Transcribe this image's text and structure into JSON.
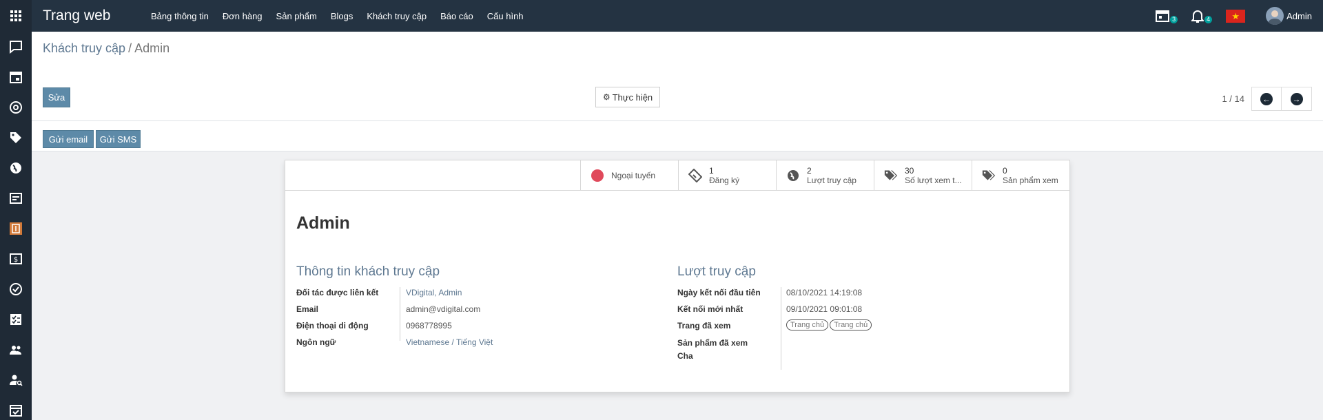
{
  "topbar": {
    "brand": "Trang web",
    "menu": [
      "Bảng thông tin",
      "Đơn hàng",
      "Sản phẩm",
      "Blogs",
      "Khách truy cập",
      "Báo cáo",
      "Cấu hình"
    ],
    "activity_count": "3",
    "notification_count": "4",
    "user": "Admin"
  },
  "sidebar": {
    "icons": [
      "discuss-icon",
      "calendar-icon",
      "email-marketing-icon",
      "tag-icon",
      "website-icon",
      "notes-icon",
      "invoice-app-icon",
      "billing-icon",
      "approvals-icon",
      "tasks-icon",
      "employees-icon",
      "recruitment-icon",
      "timeoff-icon"
    ]
  },
  "control_panel": {
    "breadcrumb_parent": "Khách truy cập",
    "breadcrumb_sep": "/",
    "breadcrumb_current": "Admin",
    "edit_label": "Sửa",
    "action_label": "Thực hiện",
    "pager_value": "1 / 14"
  },
  "statusbar": {
    "email_label": "Gửi email",
    "sms_label": "Gửi SMS"
  },
  "smart_buttons": {
    "status": "Ngoại tuyến",
    "signups_count": "1",
    "signups_label": "Đăng ký",
    "visits_count": "2",
    "visits_label": "Lượt truy cập",
    "pageviews_count": "30",
    "pageviews_label": "Số lượt xem t...",
    "products_count": "0",
    "products_label": "Sản phẩm xem"
  },
  "record": {
    "name": "Admin",
    "visitor_group": {
      "title": "Thông tin khách truy cập",
      "partner_label": "Đối tác được liên kết",
      "partner_value": "VDigital, Admin",
      "email_label": "Email",
      "email_value": "admin@vdigital.com",
      "mobile_label": "Điện thoại di động",
      "mobile_value": "0968778995",
      "lang_label": "Ngôn ngữ",
      "lang_value": "Vietnamese / Tiếng Việt"
    },
    "visits_group": {
      "title": "Lượt truy cập",
      "first_label": "Ngày kết nối đầu tiên",
      "first_value": "08/10/2021 14:19:08",
      "last_label": "Kết nối mới nhất",
      "last_value": "09/10/2021 09:01:08",
      "pages_label": "Trang đã xem",
      "pages_tags": [
        "Trang chủ",
        "Trang chủ"
      ],
      "products_label": "Sản phẩm đã xem",
      "parent_label": "Cha"
    }
  },
  "colors": {
    "topbar": "#243342",
    "sidebar": "#1f2a36",
    "primary_button": "#5d8aa8",
    "link": "#5e7891",
    "offline_dot": "#e0495b"
  }
}
